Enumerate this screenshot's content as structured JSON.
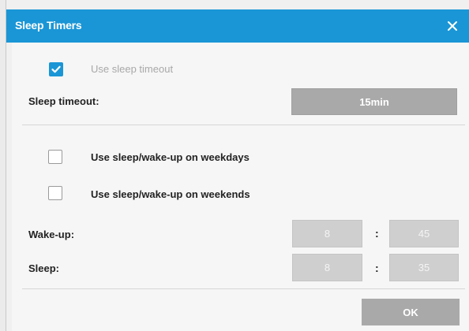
{
  "window": {
    "title": "Sleep Timers",
    "close_icon": "close-icon"
  },
  "sleep_timeout": {
    "use_label": "Use sleep timeout",
    "use_checked": true,
    "timeout_label": "Sleep timeout:",
    "timeout_value": "15min"
  },
  "schedule": {
    "weekdays_label": "Use sleep/wake-up on weekdays",
    "weekdays_checked": false,
    "weekends_label": "Use sleep/wake-up on weekends",
    "weekends_checked": false,
    "wakeup_label": "Wake-up:",
    "wakeup_hour": "8",
    "wakeup_minute": "45",
    "sleep_label": "Sleep:",
    "sleep_hour": "8",
    "sleep_minute": "35",
    "separator": ":"
  },
  "footer": {
    "ok_label": "OK"
  },
  "colors": {
    "accent": "#1a96d6",
    "button_gray": "#a9a9a9"
  }
}
